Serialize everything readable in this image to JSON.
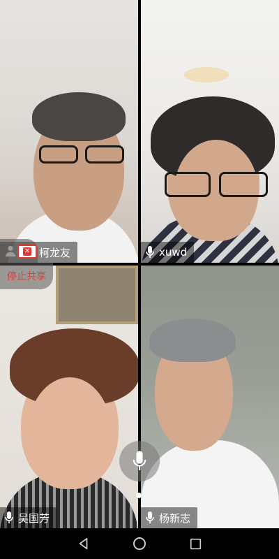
{
  "participants": [
    {
      "name": "柯龙友"
    },
    {
      "name": "xuwd"
    },
    {
      "name": "吴国芳"
    },
    {
      "name": "杨新志"
    }
  ],
  "screen_share": {
    "stop_label": "停止共享"
  },
  "icons": {
    "mic": "mic-icon",
    "share": "screen-share-icon",
    "back": "back-icon",
    "home": "home-icon",
    "recents": "recents-icon"
  },
  "colors": {
    "stop_share_text": "#e53935",
    "label_bg": "rgba(0,0,0,0.45)"
  }
}
